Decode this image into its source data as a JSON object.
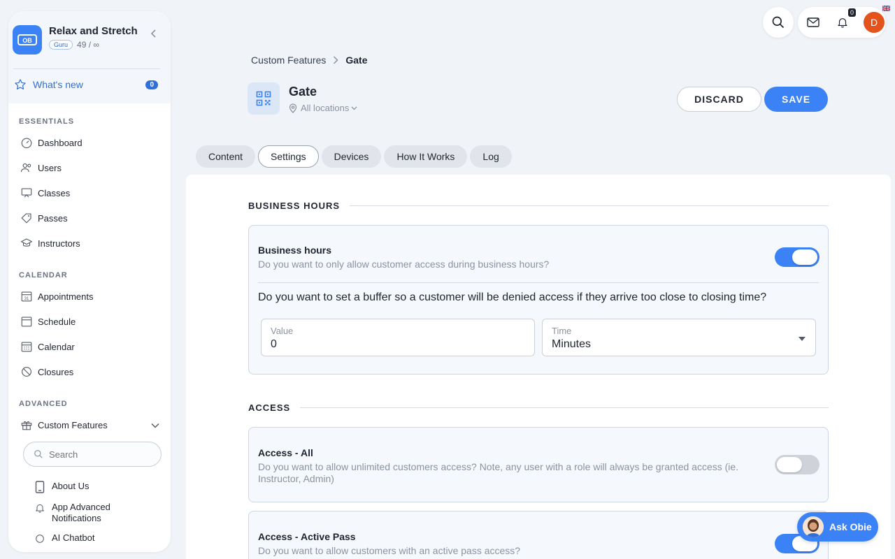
{
  "brand": {
    "name": "Relax and Stretch",
    "badge": "Guru",
    "meta": "49 / ∞"
  },
  "whats_new": {
    "label": "What's new",
    "count": "0"
  },
  "sections": {
    "essentials": "ESSENTIALS",
    "calendar": "CALENDAR",
    "advanced": "ADVANCED"
  },
  "nav": {
    "dashboard": "Dashboard",
    "users": "Users",
    "classes": "Classes",
    "passes": "Passes",
    "instructors": "Instructors",
    "appointments": "Appointments",
    "schedule": "Schedule",
    "calendar": "Calendar",
    "closures": "Closures",
    "custom_features": "Custom Features"
  },
  "sidebar_search": {
    "placeholder": "Search"
  },
  "sub_items": {
    "about_us": "About Us",
    "app_advanced_notifications": "App Advanced Notifications",
    "ai_chatbot": "AI Chatbot"
  },
  "topbar": {
    "notification_count": "0",
    "avatar_initial": "D"
  },
  "breadcrumb": {
    "parent": "Custom Features",
    "current": "Gate"
  },
  "feature": {
    "title": "Gate",
    "locations": "All locations"
  },
  "actions": {
    "discard": "DISCARD",
    "save": "SAVE"
  },
  "tabs": [
    "Content",
    "Settings",
    "Devices",
    "How It Works",
    "Log"
  ],
  "active_tab": "Settings",
  "business_hours": {
    "section_title": "BUSINESS HOURS",
    "title": "Business hours",
    "description": "Do you want to only allow customer access during business hours?",
    "enabled": true,
    "question": "Do you want to set a buffer so a customer will be denied access if they arrive too close to closing time?",
    "value_label": "Value",
    "value": "0",
    "time_label": "Time",
    "time_value": "Minutes"
  },
  "access": {
    "section_title": "ACCESS",
    "all": {
      "title": "Access - All",
      "description": "Do you want to allow unlimited customers access? Note, any user with a role will always be granted access (ie. Instructor, Admin)",
      "enabled": false
    },
    "active_pass": {
      "title": "Access - Active Pass",
      "description": "Do you want to allow customers with an active pass access?",
      "enabled": true
    }
  },
  "assistant": {
    "label": "Ask Obie"
  },
  "colors": {
    "accent": "#3b82f6",
    "avatar": "#e4531c"
  }
}
